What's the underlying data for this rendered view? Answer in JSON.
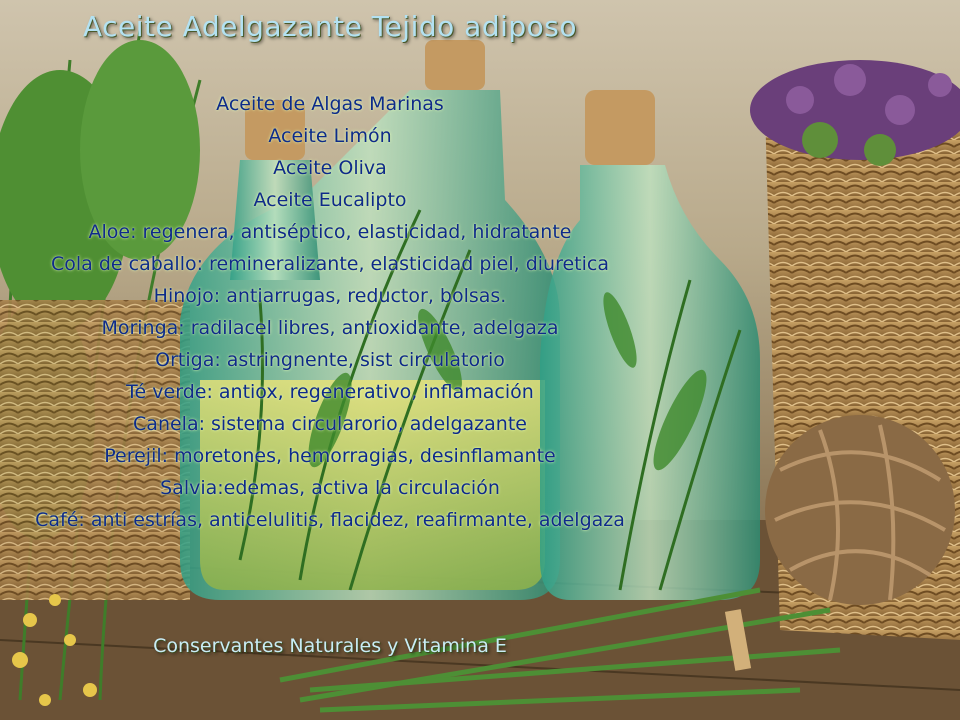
{
  "title": "Aceite Adelgazante Tejido adiposo",
  "lines": [
    "Aceite de  Algas Marinas",
    "Aceite Limón",
    "Aceite Oliva",
    "Aceite Eucalipto",
    "Aloe: regenera, antiséptico, elasticidad, hidratante",
    "Cola de caballo: remineralizante, elasticidad piel, diuretica",
    "Hinojo: antiarrugas, reductor, bolsas.",
    "Moringa: radilacel libres, antioxidante, adelgaza",
    "Ortiga: astringnente, sist circulatorio",
    "Té verde: antiox, regenerativo, inflamación",
    "Canela:  sistema circularorio, adelgazante",
    "Perejil: moretones, hemorragias, desinflamante",
    "Salvia:edemas, activa la circulación",
    "Café: anti estrías,  anticelulitis, flacidez, reafirmante, adelgaza"
  ],
  "footer": "Conservantes Naturales y Vitamina E",
  "colors": {
    "title": "#b3e1f1",
    "body_text": "#0e2a8a",
    "footer": "#c9ecf5"
  }
}
